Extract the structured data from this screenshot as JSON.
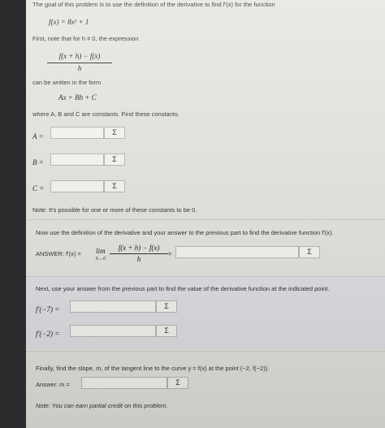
{
  "intro": "The goal of this problem is to use the definition of the derivative to find f'(x) for the function",
  "function_def": "f(x) = 8x² + 1",
  "first_note": "First, note that for h ≠ 0, the expression",
  "diff_quotient": {
    "numerator": "f(x + h) − f(x)",
    "denominator": "h"
  },
  "can_be_written": "can be written in the form",
  "form": "Ax + Bh + C",
  "where_text": "where A, B and C are constants. Find these constants.",
  "constants": [
    {
      "label": "A =",
      "value": ""
    },
    {
      "label": "B =",
      "value": ""
    },
    {
      "label": "C =",
      "value": ""
    }
  ],
  "sigma": "Σ",
  "note_zero": "Note: It's possible for one or more of these constants to be 0.",
  "now_use": "Now use the definition of the derivative and your answer to the previous part to find the derivative function f'(x).",
  "answer_label": "ANSWER: f'(x) =",
  "lim_label": "lim",
  "lim_sub": "h→0",
  "equals": "=",
  "derivative_value": "",
  "next_use": "Next, use your answer from the previous part to find the value of the derivative function at the indicated point.",
  "points": [
    {
      "label": "f'(−7) =",
      "value": ""
    },
    {
      "label": "f'(−2) =",
      "value": ""
    }
  ],
  "finally": "Finally, find the slope, m, of the tangent line to the curve y = f(x) at the point (−2, f(−2)).",
  "slope_label": "Answer: m =",
  "slope_value": "",
  "partial_note": "Note: You can earn partial credit on this problem."
}
